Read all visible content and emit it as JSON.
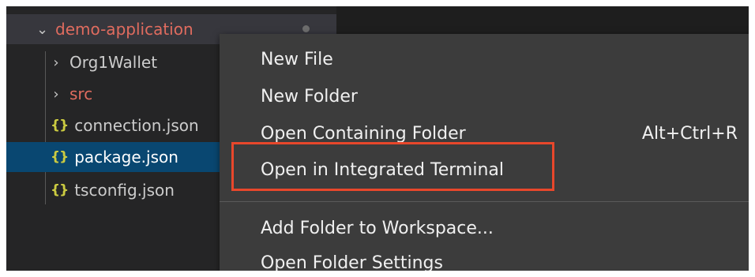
{
  "explorer": {
    "root": {
      "label": "demo-application",
      "chevron": "chevron-down-icon"
    },
    "items": [
      {
        "label": "Org1Wallet",
        "kind": "folder",
        "icon": "chevron-right-icon"
      },
      {
        "label": "src",
        "kind": "folder",
        "icon": "chevron-right-icon"
      },
      {
        "label": "connection.json",
        "kind": "file",
        "icon": "json-file-icon",
        "glyph": "{}"
      },
      {
        "label": "package.json",
        "kind": "file",
        "icon": "json-file-icon",
        "glyph": "{}"
      },
      {
        "label": "tsconfig.json",
        "kind": "file",
        "icon": "json-file-icon",
        "glyph": "{}"
      }
    ]
  },
  "context_menu": {
    "items": [
      {
        "label": "New File",
        "shortcut": ""
      },
      {
        "label": "New Folder",
        "shortcut": ""
      },
      {
        "label": "Open Containing Folder",
        "shortcut": "Alt+Ctrl+R"
      },
      {
        "label": "Open in Integrated Terminal",
        "shortcut": ""
      },
      {
        "label": "Add Folder to Workspace...",
        "shortcut": ""
      },
      {
        "label": "Open Folder Settings",
        "shortcut": ""
      }
    ]
  },
  "colors": {
    "highlight_border": "#e8472b",
    "modified_folder_text": "#e06c5f",
    "json_icon": "#cbcb41",
    "selection": "#094771"
  }
}
